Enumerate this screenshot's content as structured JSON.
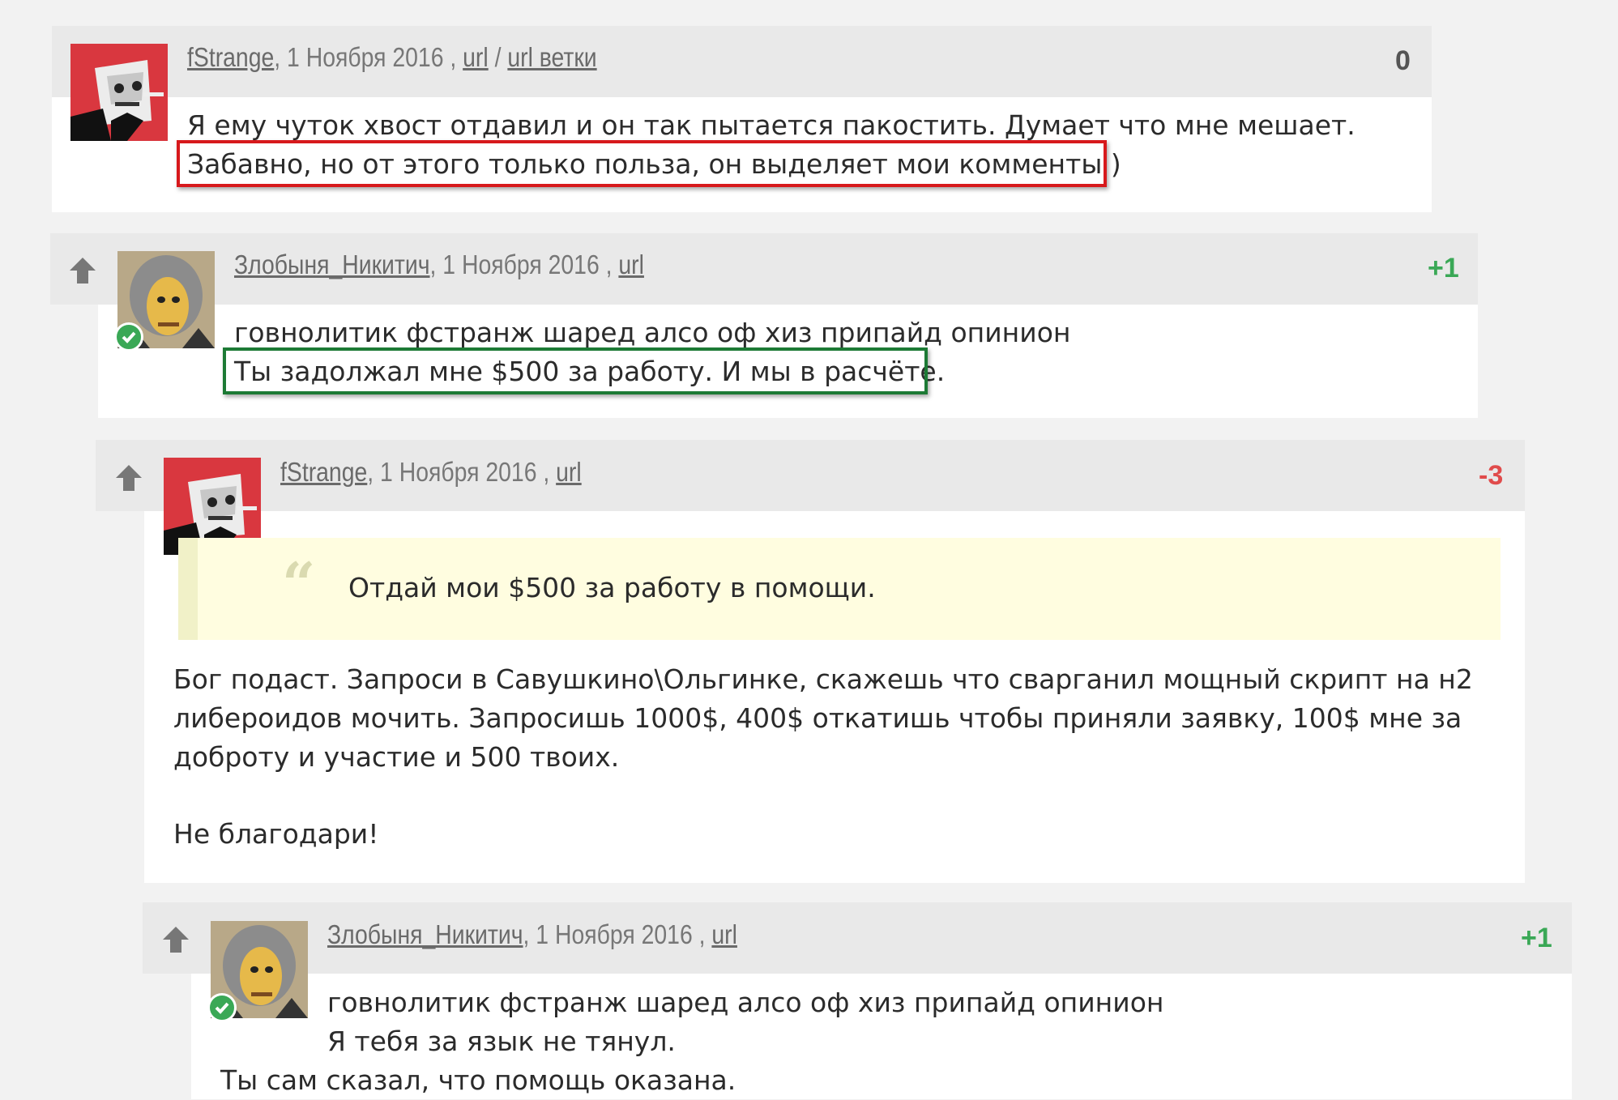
{
  "colors": {
    "positive": "#3aa856",
    "negative": "#e04b4b",
    "neutral": "#555555"
  },
  "comments": [
    {
      "author": "fStrange",
      "date": ", 1 Ноября 2016 , ",
      "url": "url",
      "sep": " / ",
      "branch": "url ветки",
      "score": "0",
      "lines": [
        "Я ему чуток хвост отдавил и он так пытается пакостить. Думает что мне мешает.",
        "Забавно, но от этого только польза, он выделяет мои комменты )"
      ]
    },
    {
      "author": "Злобыня_Никитич",
      "date": ", 1 Ноября 2016 , ",
      "url": "url",
      "score": "+1",
      "lines": [
        "говнолитик фстранж шаред алсо оф хиз припайд опинион",
        "Ты задолжал мне $500 за работу. И мы в расчёте."
      ]
    },
    {
      "author": "fStrange",
      "date": ", 1 Ноября 2016 , ",
      "url": "url",
      "score": "-3",
      "quote_mark": "“",
      "quote": "Отдай мои $500 за работу в помощи.",
      "lines": [
        "Бог подаст. Запроси в Савушкино\\Ольгинке, скажешь что сварганил мощный скрипт на н2",
        "либероидов мочить. Запросишь 1000$, 400$ откатишь чтобы приняли заявку, 100$ мне за",
        "доброту и участие и 500 твоих.",
        "Не благодари!"
      ]
    },
    {
      "author": "Злобыня_Никитич",
      "date": ", 1 Ноября 2016 , ",
      "url": "url",
      "score": "+1",
      "lines": [
        "говнолитик фстранж шаред алсо оф хиз припайд опинион",
        "Я тебя за язык не тянул.",
        "Ты сам сказал, что помощь оказана."
      ]
    }
  ]
}
